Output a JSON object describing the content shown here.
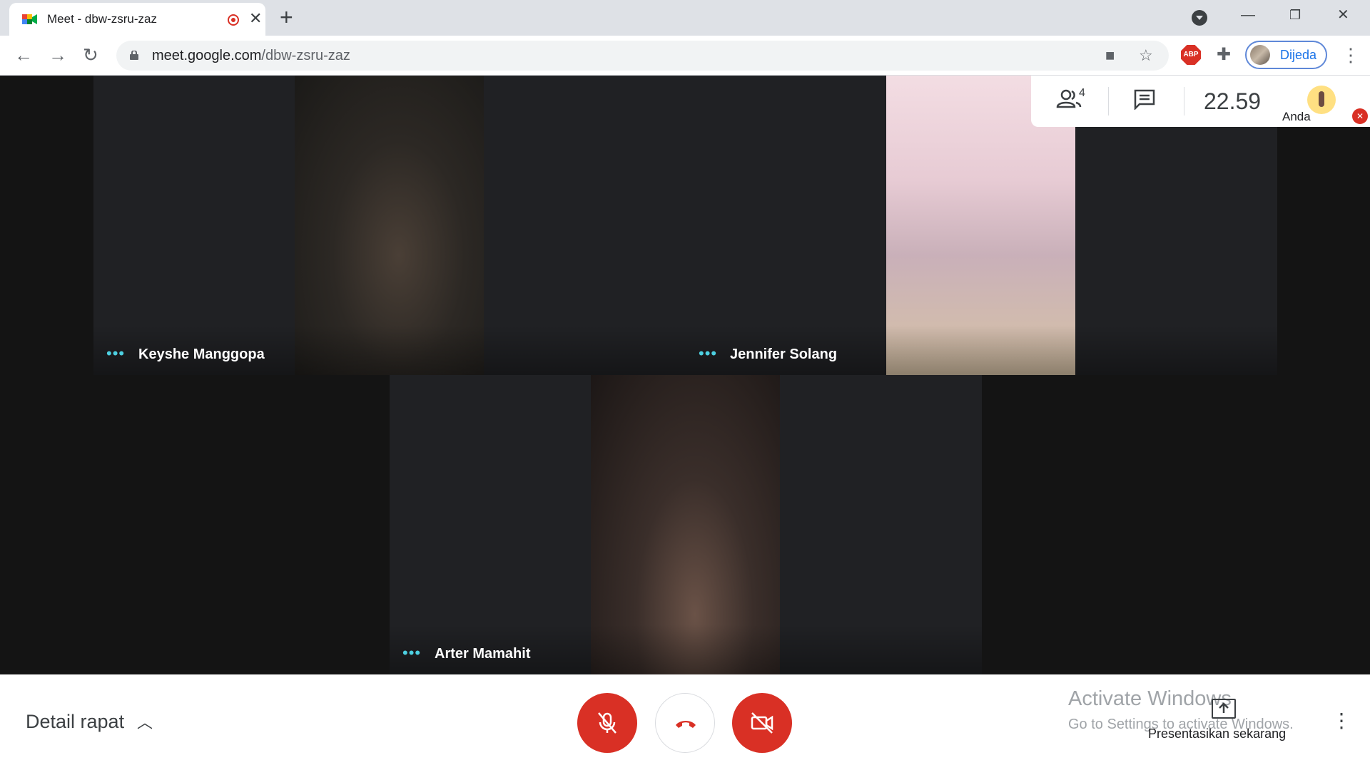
{
  "browser": {
    "tab_title": "Meet - dbw-zsru-zaz",
    "url_host": "meet.google.com",
    "url_path": "/dbw-zsru-zaz",
    "profile_label": "Dijeda",
    "abp_label": "ABP"
  },
  "meeting": {
    "participant_count": "4",
    "clock": "22.59",
    "self_label": "Anda",
    "participants": [
      {
        "name": "Keyshe Manggopa"
      },
      {
        "name": "Jennifer Solang"
      },
      {
        "name": "Arter Mamahit"
      }
    ]
  },
  "bottom": {
    "details_label": "Detail rapat",
    "present_label": "Presentasikan sekarang",
    "activate_title": "Activate Windows",
    "activate_sub": "Go to Settings to activate Windows."
  },
  "colors": {
    "danger": "#d93025",
    "accent": "#1a73e8",
    "stage": "#202124",
    "speaking_dots": "#4dd0e1"
  },
  "icons": [
    "meet-favicon",
    "record-icon",
    "close-icon",
    "plus-icon",
    "tab-search-icon",
    "minimize-icon",
    "restore-icon",
    "back-icon",
    "forward-icon",
    "reload-icon",
    "lock-icon",
    "camera-icon",
    "star-icon",
    "abp-icon",
    "puzzle-icon",
    "menu-dots-icon",
    "people-icon",
    "chat-icon",
    "mic-off-icon",
    "hangup-icon",
    "camera-off-icon",
    "present-icon",
    "more-icon"
  ]
}
